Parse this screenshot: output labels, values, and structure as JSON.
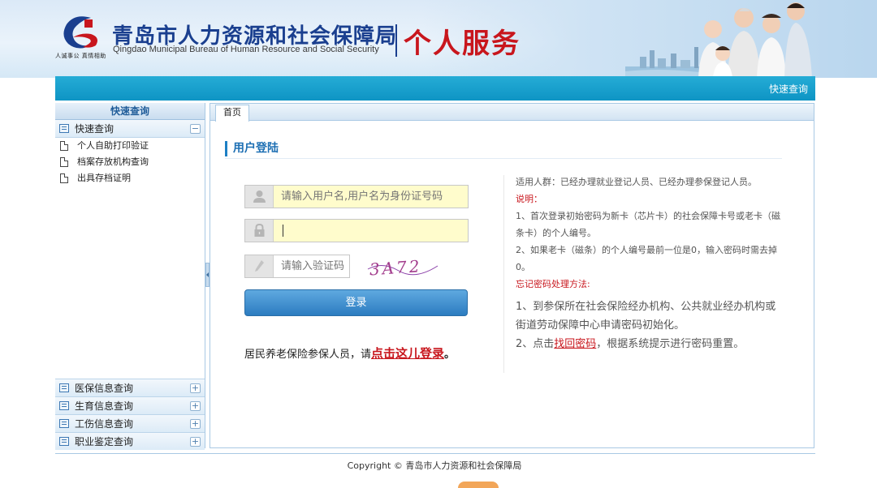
{
  "header": {
    "logo_slogan": "人诚事公 真情相助",
    "bureau_cn": "青岛市人力资源和社会保障局",
    "bureau_en": "Qingdao Municipal Bureau of Human Resource and Social Security",
    "service_title": "个人服务"
  },
  "topbar": {
    "quick_query_link": "快速查询"
  },
  "sidebar": {
    "header": "快速查询",
    "groups": [
      {
        "label": "快速查询",
        "toggle": "−",
        "items": [
          {
            "label": "个人自助打印验证"
          },
          {
            "label": "档案存放机构查询"
          },
          {
            "label": "出具存档证明"
          }
        ]
      },
      {
        "label": "医保信息查询",
        "toggle": "+"
      },
      {
        "label": "生育信息查询",
        "toggle": "+"
      },
      {
        "label": "工伤信息查询",
        "toggle": "+"
      },
      {
        "label": "职业鉴定查询",
        "toggle": "+"
      }
    ]
  },
  "tabs": [
    {
      "label": "首页",
      "active": true
    }
  ],
  "login": {
    "title": "用户登陆",
    "username_placeholder": "请输入用户名,用户名为身份证号码",
    "password_value": "",
    "captcha_placeholder": "请输入验证码",
    "captcha_text": "3A72",
    "button": "登录",
    "resident_prefix": "居民养老保险参保人员，请",
    "resident_link": "点击这儿登录",
    "resident_suffix": "。"
  },
  "info": {
    "applicable": "适用人群：已经办理就业登记人员、已经办理参保登记人员。",
    "notes_title": "说明：",
    "note1": "1、首次登录初始密码为新卡（芯片卡）的社会保障卡号或老卡（磁条卡）的个人编号。",
    "note2": "2、如果老卡（磁条）的个人编号最前一位是0，输入密码时需去掉0。",
    "forgot_title": "忘记密码处理方法:",
    "method1": "1、到参保所在社会保险经办机构、公共就业经办机构或街道劳动保障中心申请密码初始化。",
    "method2_prefix": "2、点击",
    "method2_link": "找回密码",
    "method2_suffix": "，根据系统提示进行密码重置。"
  },
  "footer": {
    "copyright": "Copyright © 青岛市人力资源和社会保障局"
  },
  "colors": {
    "brand_blue": "#1a3f8f",
    "accent_red": "#c8161d",
    "topbar_blue": "#1aa0cd"
  }
}
